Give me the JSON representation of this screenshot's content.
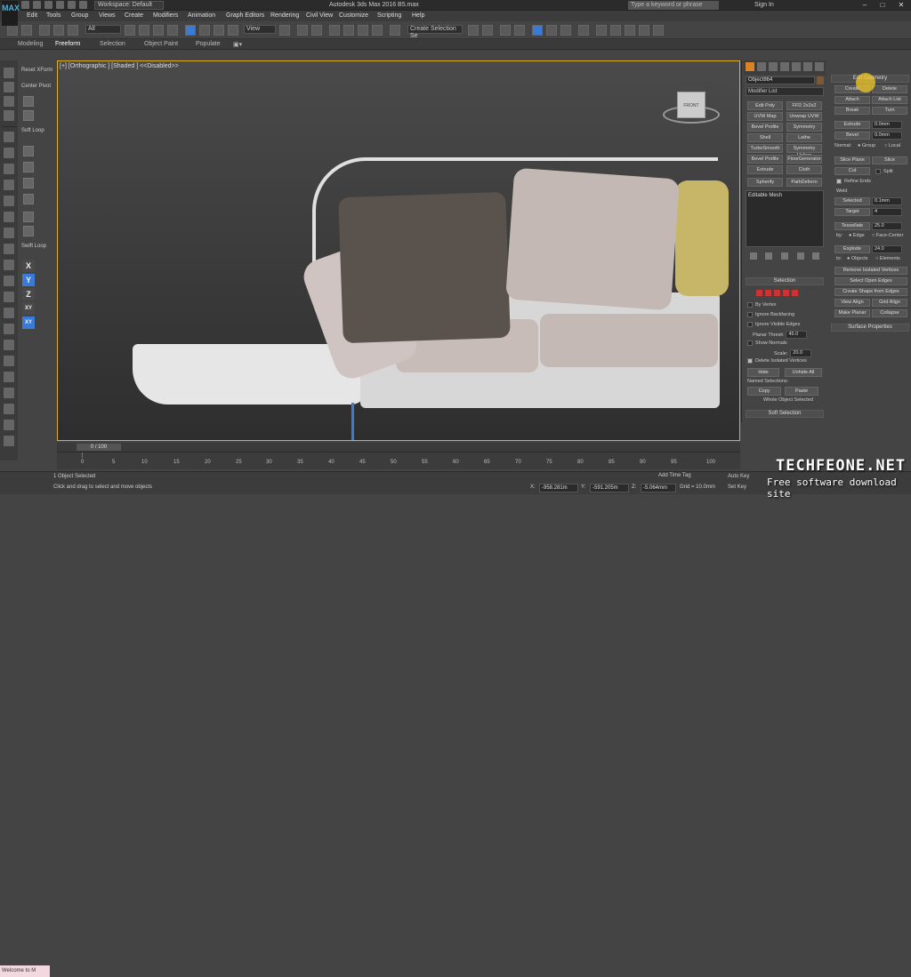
{
  "titlebar": {
    "logo": "MAX",
    "workspace": "Workspace: Default",
    "title": "Autodesk 3ds Max 2016      B5.max",
    "search_placeholder": "Type a keyword or phrase",
    "sign_in": "Sign In"
  },
  "menu": [
    "Edit",
    "Tools",
    "Group",
    "Views",
    "Create",
    "Modifiers",
    "Animation",
    "Graph Editors",
    "Rendering",
    "Civil View",
    "Customize",
    "Scripting",
    "Help"
  ],
  "toolbar": {
    "filter": "All",
    "view": "View",
    "selection_set": "Create Selection Se"
  },
  "ribbon": {
    "tabs": [
      "Modeling",
      "Freeform",
      "Selection",
      "Object Paint",
      "Populate"
    ],
    "active": "Freeform"
  },
  "tool_panel": {
    "reset_xform": "Reset XForm",
    "center_pivot": "Center Pivot",
    "soft_loop_1": "Soft Loop",
    "soft_loop_2": "Swift Loop",
    "axes": [
      "X",
      "Y",
      "Z",
      "XY",
      "XY"
    ]
  },
  "viewport": {
    "label": "[+] [Orthographic ] [Shaded ] <<Disabled>>",
    "viewcube": "FRONT"
  },
  "command_panel": {
    "object_name": "Object864",
    "modifier_list": "Modifier List",
    "modifiers": [
      "Edit Poly",
      "FFD 2x2x2",
      "UVW Map",
      "Unwrap UVW",
      "Bevel Profile",
      "Symmetry",
      "Shell",
      "Lathe",
      "TurboSmooth",
      "Symmetry Helper",
      "Bevel Profile",
      "FloorGenerator",
      "Extrude",
      "Cloth",
      "Spherify",
      "PathDeform"
    ],
    "stack_item": "Editable Mesh",
    "selection": {
      "header": "Selection",
      "by_vertex": "By Vertex",
      "ignore_backfacing": "Ignore Backfacing",
      "ignore_visible_edges": "Ignore Visible Edges",
      "planar_thresh": "Planar Thresh",
      "planar_thresh_val": "45.0",
      "show_normals": "Show Normals",
      "scale": "Scale:",
      "scale_val": "20.0",
      "delete_isolated": "Delete Isolated Vertices",
      "hide": "Hide",
      "unhide_all": "Unhide All",
      "named_selections": "Named Selections:",
      "copy": "Copy",
      "paste": "Paste",
      "whole_object": "Whole Object Selected"
    },
    "soft_selection": "Soft Selection"
  },
  "edit_geometry": {
    "header": "Edit Geometry",
    "create": "Create",
    "delete": "Delete",
    "attach": "Attach",
    "attach_list": "Attach List",
    "break": "Break",
    "turn": "Turn",
    "extrude": "Extrude",
    "extrude_val": "0.0mm",
    "bevel": "Bevel",
    "bevel_val": "0.0mm",
    "normal": "Normal:",
    "group": "Group",
    "local": "Local",
    "slice_plane": "Slice Plane",
    "slice": "Slice",
    "cut": "Cut",
    "split": "Split",
    "refine_ends": "Refine Ends",
    "weld": "Weld",
    "selected": "Selected",
    "selected_val": "0.1mm",
    "target": "Target",
    "target_val": "4",
    "tessellate": "Tessellate",
    "tessellate_val": "25.0",
    "by": "by:",
    "edge": "Edge",
    "face_center": "Face-Center",
    "explode": "Explode",
    "explode_val": "24.0",
    "to": "to:",
    "objects": "Objects",
    "elements": "Elements",
    "remove_isolated": "Remove Isolated Vertices",
    "select_open_edges": "Select Open Edges",
    "create_shape": "Create Shape from Edges",
    "view_align": "View Align",
    "grid_align": "Grid Align",
    "make_planar": "Make Planar",
    "collapse": "Collapse",
    "surface_properties": "Surface Properties"
  },
  "timeline": {
    "slider": "0 / 100",
    "ticks": [
      "0",
      "5",
      "10",
      "15",
      "20",
      "25",
      "30",
      "35",
      "40",
      "45",
      "50",
      "55",
      "60",
      "65",
      "70",
      "75",
      "80",
      "85",
      "90",
      "95",
      "100"
    ]
  },
  "status": {
    "welcome": "Welcome to M",
    "selected": "1 Object Selected",
    "prompt": "Click and drag to select and move objects",
    "x_label": "X:",
    "x": "-958.281m",
    "y_label": "Y:",
    "y": "-591.205m",
    "z_label": "Z:",
    "z": "-5.064mm",
    "grid": "Grid = 10.0mm",
    "add_time_tag": "Add Time Tag",
    "auto_key": "Auto Key",
    "set_key": "Set Key"
  },
  "watermark": {
    "title": "TECHFEONE.NET",
    "subtitle": "Free software download site"
  },
  "colors": {
    "accent": "#3a7bd5",
    "viewport_border": "#e0b020",
    "cushion": "#c8bcb8",
    "pillow_dark": "#5a524d"
  }
}
